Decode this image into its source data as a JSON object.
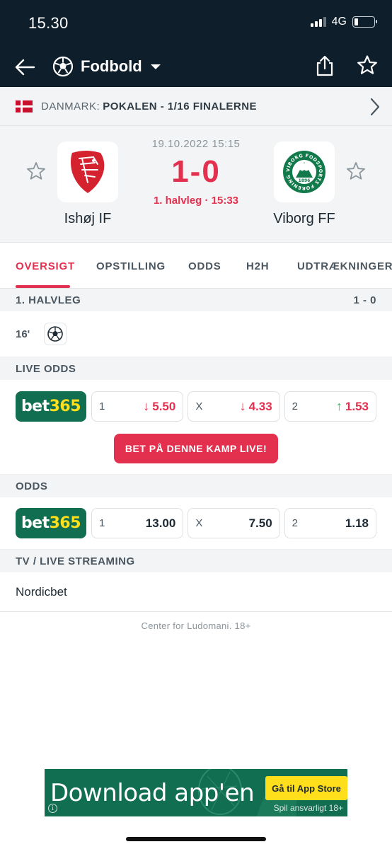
{
  "status_bar": {
    "time": "15.30",
    "network": "4G"
  },
  "nav": {
    "title": "Fodbold"
  },
  "competition": {
    "country": "DANMARK:",
    "name": "POKALEN - 1/16 FINALERNE"
  },
  "match": {
    "date": "19.10.2022 15:15",
    "score": "1-0",
    "status": "1. halvleg · 15:33",
    "home_team": "Ishøj IF",
    "away_team": "Viborg FF",
    "away_logo_text": "VIBORG FODSPORTS FORENING",
    "away_logo_year": "1896"
  },
  "tabs": [
    "OVERSIGT",
    "OPSTILLING",
    "ODDS",
    "H2H",
    "UDTRÆKNINGER"
  ],
  "first_half": {
    "title": "1. HALVLEG",
    "score": "1 - 0",
    "event_minute": "16'"
  },
  "live_odds": {
    "title": "LIVE ODDS",
    "bookmaker": {
      "part1": "bet",
      "part2": "365"
    },
    "odds": [
      {
        "label": "1",
        "value": "5.50",
        "trend": "down"
      },
      {
        "label": "X",
        "value": "4.33",
        "trend": "down"
      },
      {
        "label": "2",
        "value": "1.53",
        "trend": "up"
      }
    ],
    "cta": "BET PÅ DENNE KAMP LIVE!"
  },
  "odds": {
    "title": "ODDS",
    "bookmaker": {
      "part1": "bet",
      "part2": "365"
    },
    "odds": [
      {
        "label": "1",
        "value": "13.00"
      },
      {
        "label": "X",
        "value": "7.50"
      },
      {
        "label": "2",
        "value": "1.18"
      }
    ]
  },
  "tv": {
    "title": "TV / LIVE STREAMING",
    "channel": "Nordicbet"
  },
  "footer_note": "Center for Ludomani. 18+",
  "banner": {
    "title": "Download app'en",
    "button": "Gå til App Store",
    "responsible": "Spil ansvarligt  18+",
    "info": "i"
  },
  "colors": {
    "accent": "#e4304f",
    "header_bg": "#0e1f2b",
    "bet365_green": "#126e51",
    "bet365_yellow": "#ffdf1b",
    "up": "#2fb85a"
  }
}
